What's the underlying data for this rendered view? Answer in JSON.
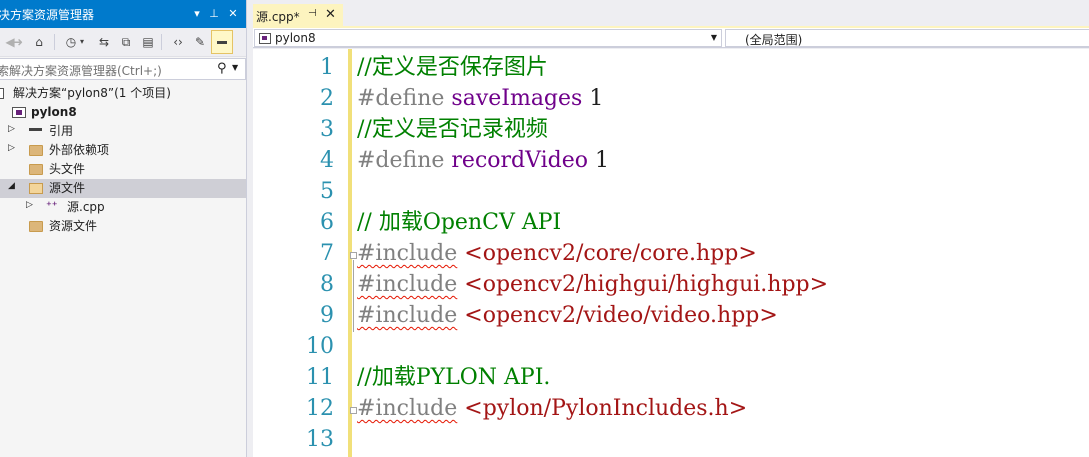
{
  "solution_explorer": {
    "title": "决方案资源管理器",
    "search_placeholder": "索解决方案资源管理器(Ctrl+;)",
    "tree": [
      {
        "label": "解决方案“pylon8”(1 个项目)",
        "bold": false
      },
      {
        "label": "pylon8",
        "bold": true
      },
      {
        "label": "引用"
      },
      {
        "label": "外部依赖项"
      },
      {
        "label": "头文件"
      },
      {
        "label": "源文件"
      },
      {
        "label": "源.cpp"
      },
      {
        "label": "资源文件"
      }
    ]
  },
  "editor": {
    "tab_label": "源.cpp*",
    "nav_left": "pylon8",
    "nav_right": "(全局范围)",
    "lines": [
      {
        "num": "1",
        "text": "//定义是否保存图片"
      },
      {
        "num": "2",
        "a": "#define ",
        "b": "saveImages",
        "c": " 1"
      },
      {
        "num": "3",
        "text": "//定义是否记录视频"
      },
      {
        "num": "4",
        "a": "#define ",
        "b": "recordVideo",
        "c": " 1"
      },
      {
        "num": "5",
        "text": ""
      },
      {
        "num": "6",
        "text": "// 加载OpenCV API"
      },
      {
        "num": "7",
        "a": "#include",
        "b": " <opencv2/core/core.hpp>"
      },
      {
        "num": "8",
        "a": "#include",
        "b": " <opencv2/highgui/highgui.hpp>"
      },
      {
        "num": "9",
        "a": "#include",
        "b": " <opencv2/video/video.hpp>"
      },
      {
        "num": "10",
        "text": ""
      },
      {
        "num": "11",
        "text": "//加载PYLON API."
      },
      {
        "num": "12",
        "a": "#include",
        "b": " <pylon/PylonIncludes.h>"
      },
      {
        "num": "13",
        "text": ""
      }
    ]
  },
  "colors": {
    "accent": "#007acc",
    "line_number": "#2b91af",
    "comment": "#008000",
    "preprocessor": "#808080",
    "macro": "#6f008a",
    "string": "#a31515",
    "change_bar": "#f1e07a",
    "tab_active": "#fdf4bf"
  },
  "icons": [
    "pin-icon",
    "close-icon",
    "back-icon",
    "forward-icon",
    "home-icon",
    "history-icon",
    "sync-icon",
    "collapse-all-icon",
    "show-files-icon",
    "code-icon",
    "properties-icon",
    "preview-icon",
    "search-icon",
    "folder-icon",
    "project-icon",
    "references-icon",
    "cpp-file-icon"
  ]
}
